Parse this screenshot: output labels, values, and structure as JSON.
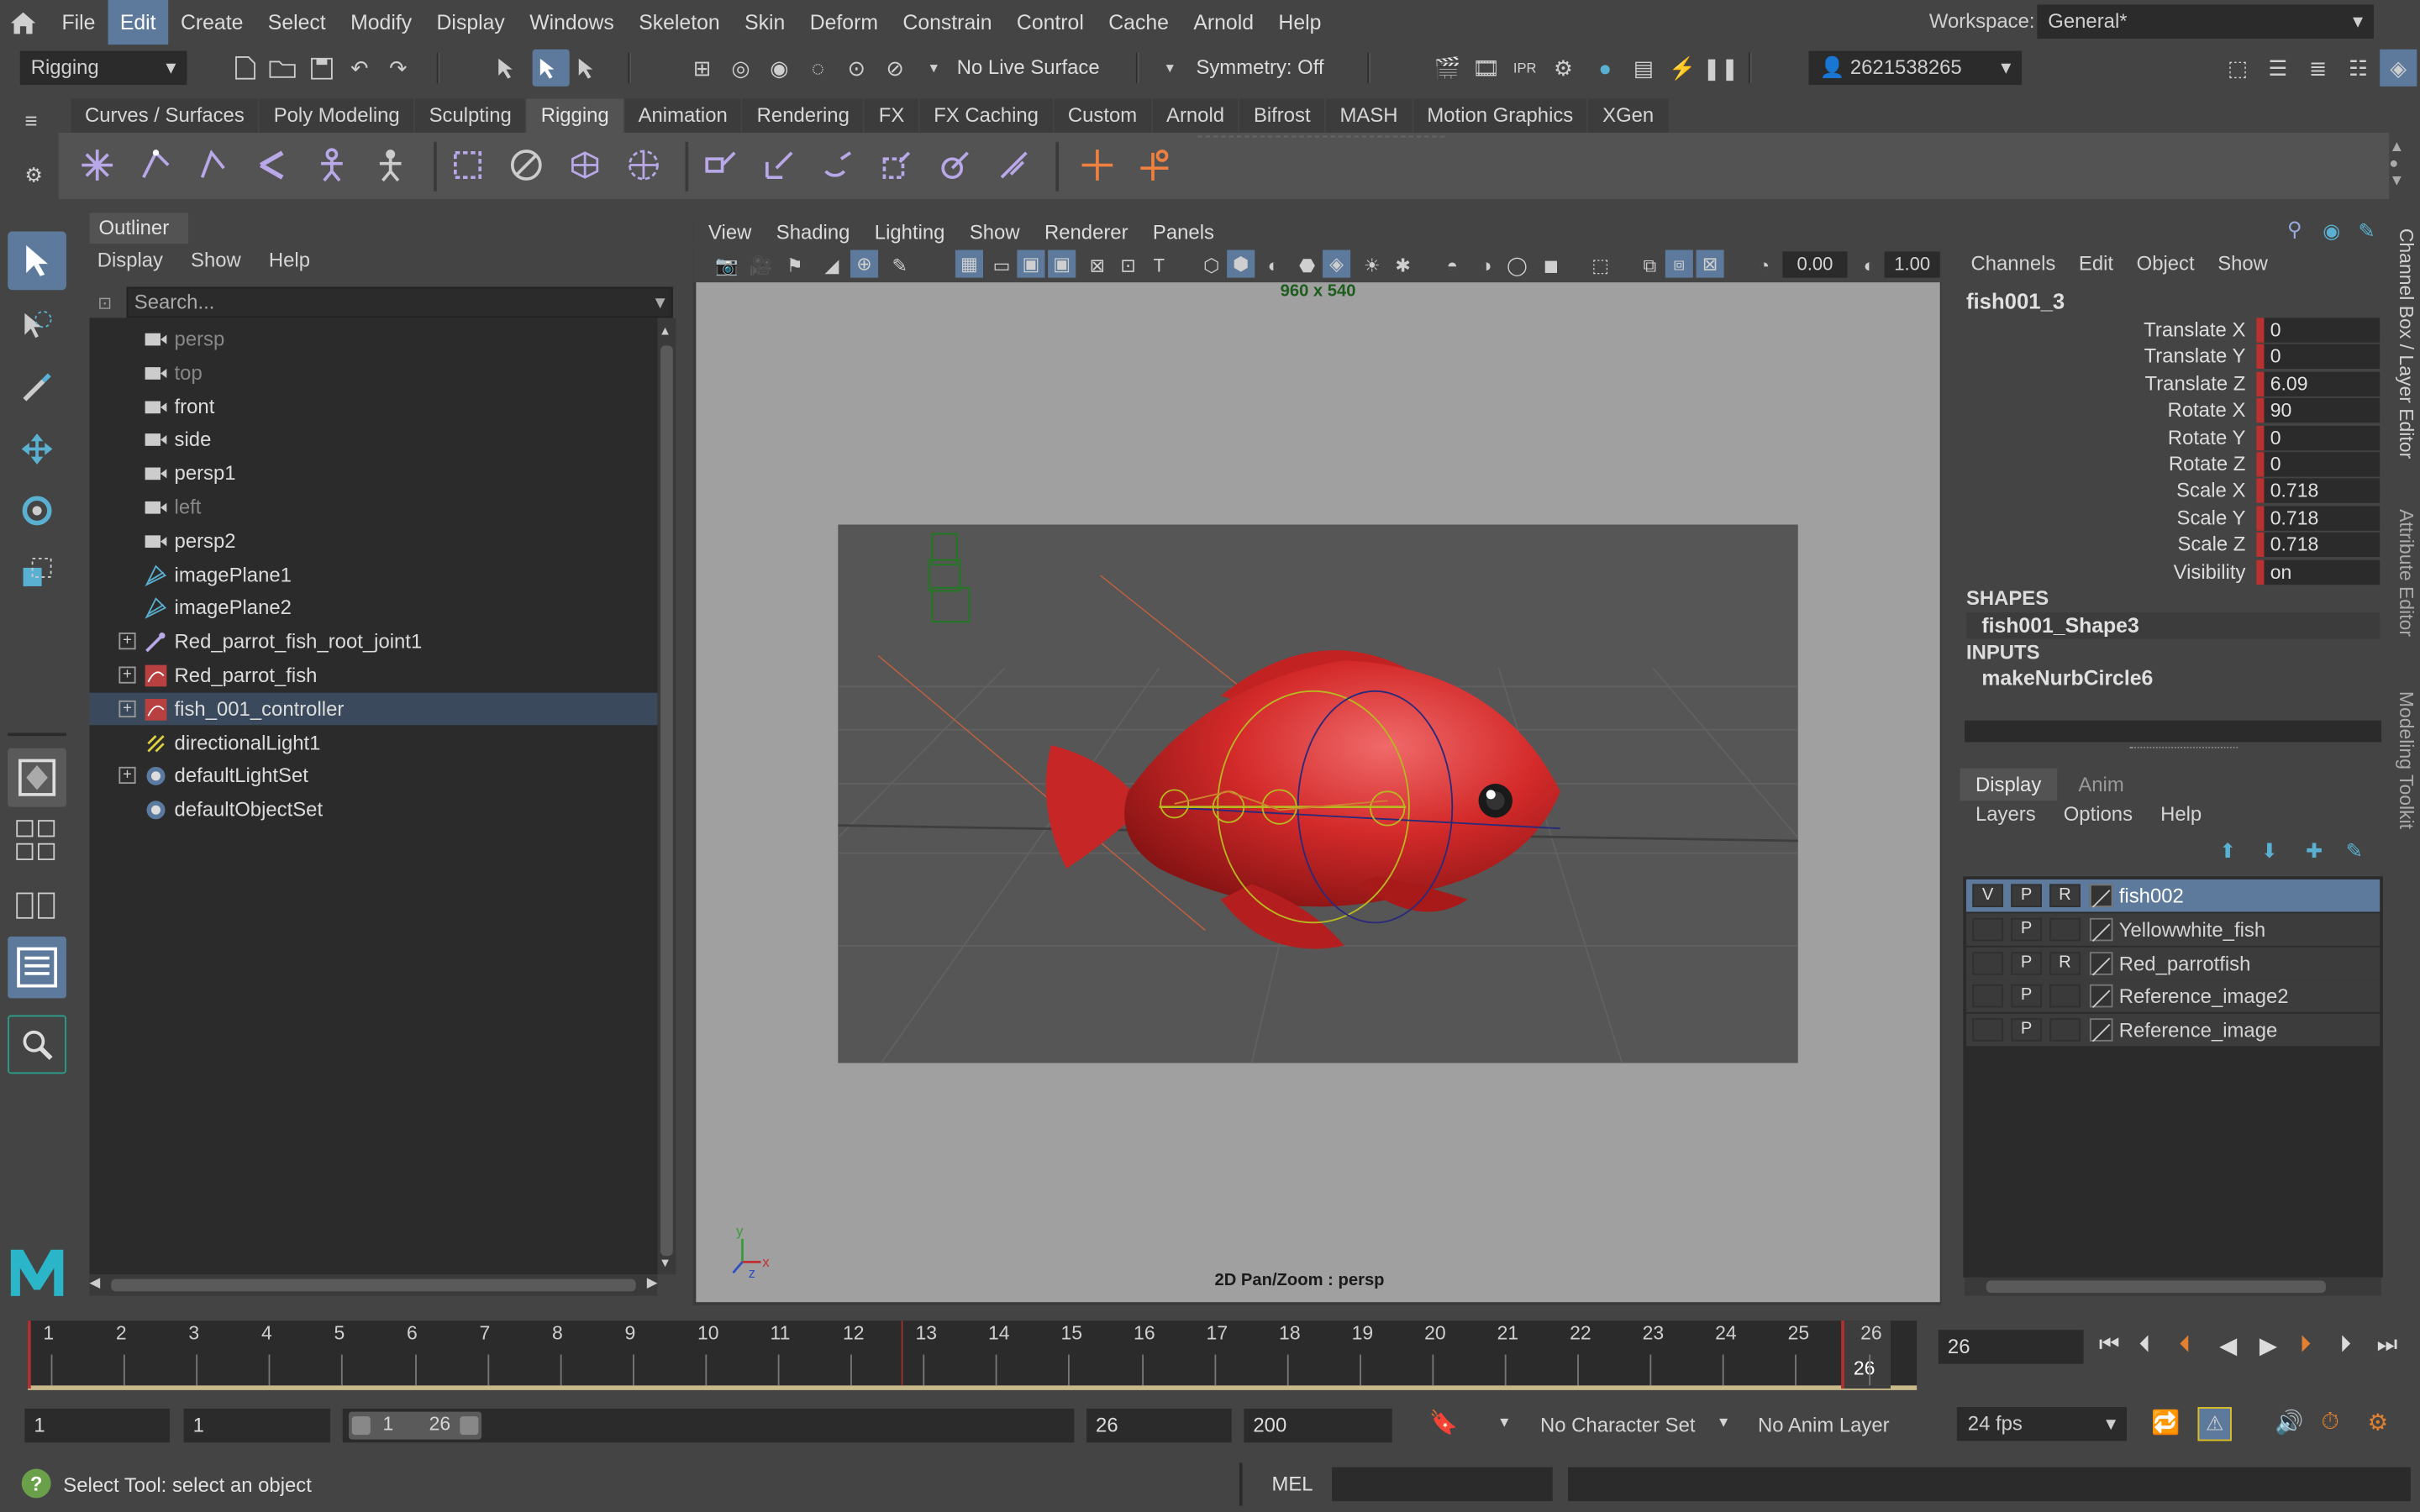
{
  "menubar": {
    "items": [
      "File",
      "Edit",
      "Create",
      "Select",
      "Modify",
      "Display",
      "Windows",
      "Skeleton",
      "Skin",
      "Deform",
      "Constrain",
      "Control",
      "Cache",
      "Arnold",
      "Help"
    ],
    "active": "Edit",
    "workspace_label": "Workspace:",
    "workspace_value": "General*"
  },
  "toolbar": {
    "mode": "Rigging",
    "live_surface": "No Live Surface",
    "symmetry": "Symmetry: Off",
    "account": "2621538265"
  },
  "shelf": {
    "tabs": [
      "Curves / Surfaces",
      "Poly Modeling",
      "Sculpting",
      "Rigging",
      "Animation",
      "Rendering",
      "FX",
      "FX Caching",
      "Custom",
      "Arnold",
      "Bifrost",
      "MASH",
      "Motion Graphics",
      "XGen"
    ],
    "active": "Rigging"
  },
  "outliner": {
    "title": "Outliner",
    "menu": [
      "Display",
      "Show",
      "Help"
    ],
    "search_placeholder": "Search...",
    "items": [
      {
        "label": "persp",
        "icon": "camera-icon",
        "dim": true,
        "expand": false
      },
      {
        "label": "top",
        "icon": "camera-icon",
        "dim": true,
        "expand": false
      },
      {
        "label": "front",
        "icon": "camera-icon",
        "dim": false,
        "expand": false
      },
      {
        "label": "side",
        "icon": "camera-icon",
        "dim": false,
        "expand": false
      },
      {
        "label": "persp1",
        "icon": "camera-icon",
        "dim": false,
        "expand": false
      },
      {
        "label": "left",
        "icon": "camera-icon",
        "dim": true,
        "expand": false
      },
      {
        "label": "persp2",
        "icon": "camera-icon",
        "dim": false,
        "expand": false
      },
      {
        "label": "imagePlane1",
        "icon": "image-plane-icon",
        "dim": false,
        "expand": false
      },
      {
        "label": "imagePlane2",
        "icon": "image-plane-icon",
        "dim": false,
        "expand": false
      },
      {
        "label": "Red_parrot_fish_root_joint1",
        "icon": "joint-icon",
        "dim": false,
        "expand": true
      },
      {
        "label": "Red_parrot_fish",
        "icon": "curve-icon",
        "dim": false,
        "expand": true
      },
      {
        "label": "fish_001_controller",
        "icon": "curve-icon",
        "dim": false,
        "expand": true,
        "selected": true
      },
      {
        "label": "directionalLight1",
        "icon": "light-icon",
        "dim": false,
        "expand": false
      },
      {
        "label": "defaultLightSet",
        "icon": "set-icon",
        "dim": false,
        "expand": true
      },
      {
        "label": "defaultObjectSet",
        "icon": "set-icon",
        "dim": false,
        "expand": false
      }
    ]
  },
  "viewport": {
    "menu": [
      "View",
      "Shading",
      "Lighting",
      "Show",
      "Renderer",
      "Panels"
    ],
    "exposure": "0.00",
    "gamma": "1.00",
    "resolution": "960 x 540",
    "footer": "2D Pan/Zoom : persp"
  },
  "channelbox": {
    "menu": [
      "Channels",
      "Edit",
      "Object",
      "Show"
    ],
    "object": "fish001_3",
    "attributes": [
      {
        "name": "Translate X",
        "value": "0"
      },
      {
        "name": "Translate Y",
        "value": "0"
      },
      {
        "name": "Translate Z",
        "value": "6.09"
      },
      {
        "name": "Rotate X",
        "value": "90"
      },
      {
        "name": "Rotate Y",
        "value": "0"
      },
      {
        "name": "Rotate Z",
        "value": "0"
      },
      {
        "name": "Scale X",
        "value": "0.718"
      },
      {
        "name": "Scale Y",
        "value": "0.718"
      },
      {
        "name": "Scale Z",
        "value": "0.718"
      },
      {
        "name": "Visibility",
        "value": "on"
      }
    ],
    "shapes_label": "SHAPES",
    "shape": "fish001_Shape3",
    "inputs_label": "INPUTS",
    "input": "makeNurbCircle6",
    "side_tabs": [
      "Channel Box / Layer Editor",
      "Attribute Editor",
      "Modeling Toolkit"
    ]
  },
  "layers": {
    "tabs": [
      "Display",
      "Anim"
    ],
    "active_tab": "Display",
    "menu": [
      "Layers",
      "Options",
      "Help"
    ],
    "rows": [
      {
        "v": "V",
        "p": "P",
        "r": "R",
        "name": "fish002",
        "selected": true
      },
      {
        "v": "",
        "p": "P",
        "r": "",
        "name": "Yellowwhite_fish"
      },
      {
        "v": "",
        "p": "P",
        "r": "R",
        "name": "Red_parrotfish"
      },
      {
        "v": "",
        "p": "P",
        "r": "",
        "name": "Reference_image2"
      },
      {
        "v": "",
        "p": "P",
        "r": "",
        "name": "Reference_image"
      }
    ]
  },
  "timeline": {
    "ticks": [
      "1",
      "2",
      "3",
      "4",
      "5",
      "6",
      "7",
      "8",
      "9",
      "10",
      "11",
      "12",
      "13",
      "14",
      "15",
      "16",
      "17",
      "18",
      "19",
      "20",
      "21",
      "22",
      "23",
      "24",
      "25",
      "26"
    ],
    "current_frame": "26",
    "current_field": "26"
  },
  "range": {
    "start": "1",
    "playback_start": "1",
    "slider_start": "1",
    "slider_end": "26",
    "playback_end": "26",
    "end": "200",
    "character_set": "No Character Set",
    "anim_layer": "No Anim Layer",
    "fps": "24 fps"
  },
  "status": {
    "help": "Select Tool: select an object",
    "mel": "MEL"
  },
  "colors": {
    "accent": "#5d7a9c",
    "fish": "#d42a2a",
    "keyed": "#b83232"
  }
}
